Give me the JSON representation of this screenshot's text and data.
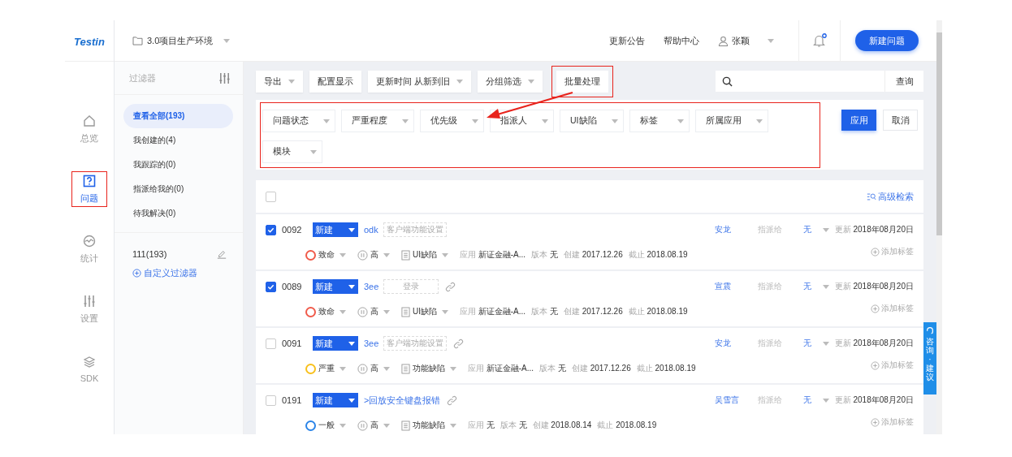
{
  "logo": "Testin",
  "project": {
    "name": "3.0项目生产环境"
  },
  "header_links": [
    "更新公告",
    "帮助中心"
  ],
  "user": {
    "name": "张颖"
  },
  "notification": {
    "unread": true
  },
  "new_button": "新建问题",
  "nav": [
    {
      "kind": "home",
      "label": "总览",
      "selected": false,
      "highlighted": false
    },
    {
      "kind": "question",
      "label": "问题",
      "selected": true,
      "highlighted": true
    },
    {
      "kind": "stats",
      "label": "统计",
      "selected": false,
      "highlighted": false
    },
    {
      "kind": "settings",
      "label": "设置",
      "selected": false,
      "highlighted": false
    },
    {
      "kind": "layers",
      "label": "SDK",
      "selected": false,
      "highlighted": false
    }
  ],
  "filter_sidebar": {
    "title": "过滤器",
    "items": [
      {
        "label": "查看全部(193)",
        "selected": true
      },
      {
        "label": "我创建的(4)",
        "selected": false
      },
      {
        "label": "我跟踪的(0)",
        "selected": false
      },
      {
        "label": "指派给我的(0)",
        "selected": false
      },
      {
        "label": "待我解决(0)",
        "selected": false
      }
    ],
    "custom": [
      {
        "label": "111(193)"
      }
    ],
    "add_link": "自定义过滤器"
  },
  "toolbar": {
    "buttons": [
      {
        "label": "导出",
        "dropdown": true,
        "highlighted": false
      },
      {
        "label": "配置显示",
        "dropdown": false,
        "highlighted": false
      },
      {
        "label": "更新时间 从新到旧",
        "dropdown": true,
        "highlighted": false
      },
      {
        "label": "分组筛选",
        "dropdown": true,
        "highlighted": false
      },
      {
        "label": "批量处理",
        "dropdown": false,
        "highlighted": true
      }
    ],
    "search_button": "查询"
  },
  "filters": {
    "highlighted": true,
    "items": [
      "问题状态",
      "严重程度",
      "优先级",
      "指派人",
      "UI缺陷",
      "标签",
      "所属应用",
      "模块"
    ],
    "apply": "应用",
    "cancel": "取消"
  },
  "annotation_arrow": true,
  "list": {
    "select_all": {
      "checked": false
    },
    "advanced_search": "高级检索",
    "rows": [
      {
        "id": "0092",
        "checked": true,
        "status": "新建",
        "title": "odk",
        "module": "客户端功能设置",
        "has_link": false,
        "assignee": "安龙",
        "assign_label": "指派给",
        "assign_value": "无",
        "updated_label": "更新",
        "updated": "2018年08月20日",
        "severity": {
          "label": "致命",
          "color": "#f05a4a"
        },
        "priority": "高",
        "type": "UI缺陷",
        "meta": [
          {
            "label": "应用",
            "value": "新证金融-A..."
          },
          {
            "label": "版本",
            "value": "无"
          },
          {
            "label": "创建",
            "value": "2017.12.26"
          },
          {
            "label": "截止",
            "value": "2018.08.19"
          }
        ],
        "add_tag": "添加标签"
      },
      {
        "id": "0089",
        "checked": true,
        "status": "新建",
        "title": "3ee",
        "module": "登录",
        "has_link": true,
        "assignee": "宣震",
        "assign_label": "指派给",
        "assign_value": "无",
        "updated_label": "更新",
        "updated": "2018年08月20日",
        "severity": {
          "label": "致命",
          "color": "#f05a4a"
        },
        "priority": "高",
        "type": "UI缺陷",
        "meta": [
          {
            "label": "应用",
            "value": "新证金融-A..."
          },
          {
            "label": "版本",
            "value": "无"
          },
          {
            "label": "创建",
            "value": "2017.12.26"
          },
          {
            "label": "截止",
            "value": "2018.08.19"
          }
        ],
        "add_tag": "添加标签"
      },
      {
        "id": "0091",
        "checked": false,
        "status": "新建",
        "title": "3ee",
        "module": "客户端功能设置",
        "has_link": true,
        "assignee": "安龙",
        "assign_label": "指派给",
        "assign_value": "无",
        "updated_label": "更新",
        "updated": "2018年08月20日",
        "severity": {
          "label": "严重",
          "color": "#f8c01c"
        },
        "priority": "高",
        "type": "功能缺陷",
        "meta": [
          {
            "label": "应用",
            "value": "新证金融-A..."
          },
          {
            "label": "版本",
            "value": "无"
          },
          {
            "label": "创建",
            "value": "2017.12.26"
          },
          {
            "label": "截止",
            "value": "2018.08.19"
          }
        ],
        "add_tag": "添加标签"
      },
      {
        "id": "0191",
        "checked": false,
        "status": "新建",
        "title": ">回放安全键盘报错",
        "has_link": true,
        "assignee": "吴雪言",
        "assign_label": "指派给",
        "assign_value": "无",
        "updated_label": "更新",
        "updated": "2018年08月20日",
        "severity": {
          "label": "一般",
          "color": "#2a84e8"
        },
        "priority": "高",
        "type": "功能缺陷",
        "meta": [
          {
            "label": "应用",
            "value": "无"
          },
          {
            "label": "版本",
            "value": "无"
          },
          {
            "label": "创建",
            "value": "2018.08.14"
          },
          {
            "label": "截止",
            "value": "2018.08.19"
          }
        ],
        "add_tag": "添加标签"
      }
    ]
  },
  "feedback_tab": "咨询·建议"
}
